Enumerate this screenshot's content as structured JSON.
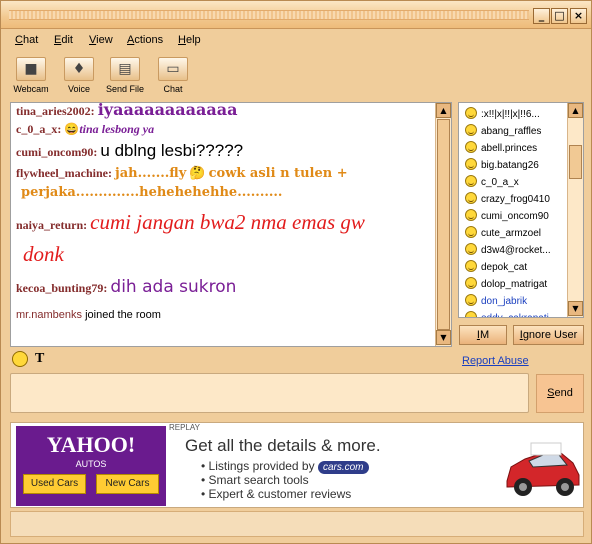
{
  "window": {
    "title": ""
  },
  "window_buttons": {
    "minimize": "_",
    "maximize": "□",
    "close": "×"
  },
  "menu": {
    "chat": {
      "u": "C",
      "rest": "hat"
    },
    "edit": {
      "u": "E",
      "rest": "dit"
    },
    "view": {
      "u": "V",
      "rest": "iew"
    },
    "actions": {
      "u": "A",
      "rest": "ctions"
    },
    "help": {
      "u": "H",
      "rest": "elp"
    }
  },
  "toolbar": {
    "webcam": "Webcam",
    "voice": "Voice",
    "send_file": "Send File",
    "chat": "Chat"
  },
  "messages": [
    {
      "nick": "tina_aries2002:",
      "text": "iyaaaaaaaaaaaa",
      "color": "#7a1f96"
    },
    {
      "nick": "c_0_a_x:",
      "emoticon": "😄",
      "text1": "tina",
      "text2": "lesbong ya",
      "color1": "#7a1f96",
      "color2": "#7a1f96"
    },
    {
      "nick": "cumi_oncom90:",
      "text": "u dblng lesbi?????",
      "color": "#000000"
    },
    {
      "nick": "flywheel_machine:",
      "text1": "jah.......fly",
      "emoticon": "🤔",
      "text2": "cowk asli n tulen +",
      "text3": "perjaka..............hehehehehhe..........",
      "color": "#e08a17"
    },
    {
      "nick": "naiya_return:",
      "text1": "cumi jangan bwa2 nma emas gw",
      "text2": "donk",
      "color": "#e21c1c"
    },
    {
      "nick": "kecoa_bunting79:",
      "text": "dih ada sukron",
      "color": "#7a1f96"
    },
    {
      "nick": "mr.nambenks",
      "text": "joined the room",
      "nick_color": "#842c2c"
    }
  ],
  "users": [
    ":x!!|x|!!|x|!!6...",
    "abang_raffles",
    "abell.princes",
    "big.batang26",
    "c_0_a_x",
    "crazy_frog0410",
    "cumi_oncom90",
    "cute_armzoel",
    "d3w4@rocket...",
    "depok_cat",
    "dolop_matrigat",
    "don_jabrik",
    "eddy_cakrapati"
  ],
  "user_buttons": {
    "im": "IM",
    "im_u": "I",
    "im_rest": "M",
    "ignore": "Ignore User",
    "ignore_u": "I",
    "ignore_rest": "gnore User"
  },
  "report_abuse": "Report Abuse",
  "send_button": {
    "u": "S",
    "rest": "end"
  },
  "ad": {
    "replay": "REPLAY",
    "brand": "YAHOO!",
    "brand_sub": "AUTOS",
    "used_cars": "Used Cars",
    "new_cars": "New Cars",
    "headline": "Get all the details & more.",
    "bullet1a": "Listings provided by",
    "cars_logo": "cars.com",
    "bullet2": "Smart search tools",
    "bullet3": "Expert & customer reviews"
  },
  "colors": {
    "window_bg": "#f0cd9b",
    "accent": "#e08a17",
    "link": "#1a3fbf"
  }
}
